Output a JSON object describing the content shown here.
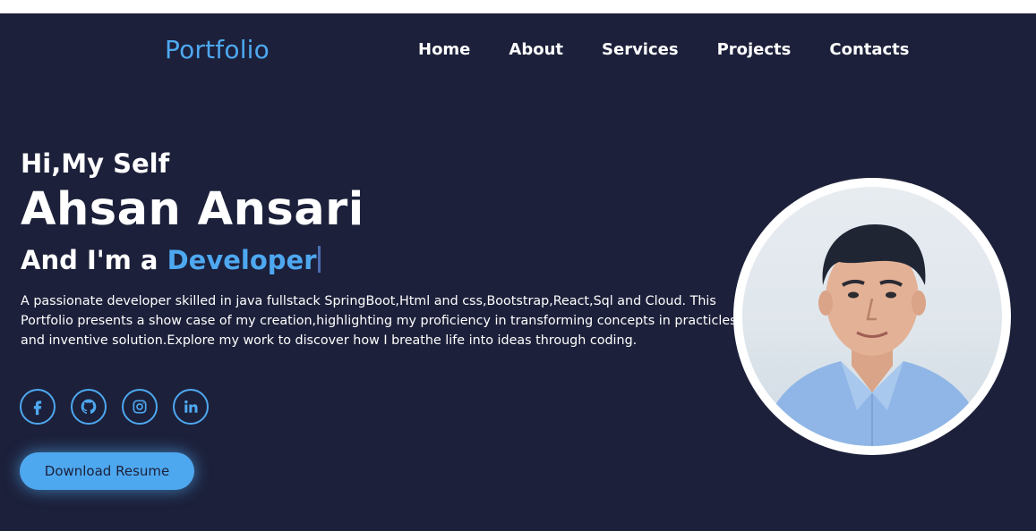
{
  "brand": {
    "logo": "Portfolio",
    "accent": "#4ea8f0",
    "background": "#1c203a"
  },
  "nav": {
    "items": [
      {
        "label": "Home"
      },
      {
        "label": "About"
      },
      {
        "label": "Services"
      },
      {
        "label": "Projects"
      },
      {
        "label": "Contacts"
      }
    ]
  },
  "hero": {
    "greeting": "Hi,My Self",
    "name": "Ahsan Ansari",
    "role_prefix": "And I'm a ",
    "role_highlight": "Developer",
    "description": "A passionate developer skilled in java fullstack SpringBoot,Html and css,Bootstrap,React,Sql and Cloud. This Portfolio presents a show case of my creation,highlighting my proficiency in transforming concepts in practicles and inventive solution.Explore my work to discover how I breathe life into ideas through coding."
  },
  "socials": [
    {
      "icon": "facebook-icon"
    },
    {
      "icon": "github-icon"
    },
    {
      "icon": "instagram-icon"
    },
    {
      "icon": "linkedin-icon"
    }
  ],
  "cta": {
    "label": "Download Resume"
  },
  "profile_photo": {
    "icon": "profile-photo"
  }
}
